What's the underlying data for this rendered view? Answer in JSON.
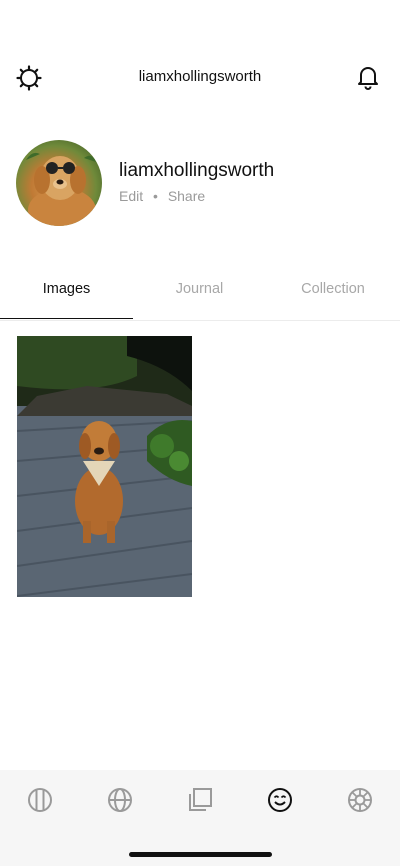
{
  "header": {
    "title": "liamxhollingsworth",
    "left_icon": "gear-icon",
    "right_icon": "bell-icon"
  },
  "profile": {
    "username": "liamxhollingsworth",
    "edit_label": "Edit",
    "separator": "•",
    "share_label": "Share"
  },
  "tabs": [
    {
      "label": "Images",
      "active": true
    },
    {
      "label": "Journal",
      "active": false
    },
    {
      "label": "Collection",
      "active": false
    }
  ],
  "bottom_nav": {
    "items": [
      {
        "icon": "columns-icon",
        "active": false
      },
      {
        "icon": "globe-icon",
        "active": false
      },
      {
        "icon": "stack-icon",
        "active": false
      },
      {
        "icon": "smiley-icon",
        "active": true
      },
      {
        "icon": "aperture-icon",
        "active": false
      }
    ]
  },
  "colors": {
    "text_primary": "#111111",
    "text_muted": "#9a9a9a",
    "tab_inactive": "#a8a8a8",
    "nav_background": "#f6f6f6",
    "icon_inactive": "#9a9a9a"
  }
}
